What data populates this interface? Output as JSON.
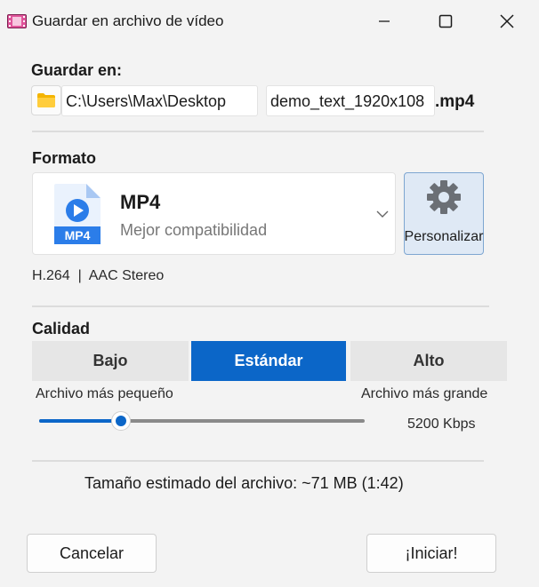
{
  "window": {
    "title": "Guardar en archivo de vídeo"
  },
  "save": {
    "label": "Guardar en:",
    "path": "C:\\Users\\Max\\Desktop",
    "filename": "demo_text_1920x108",
    "extension": ".mp4"
  },
  "format": {
    "label": "Formato",
    "name": "MP4",
    "description": "Mejor compatibilidad",
    "icon_text": "MP4",
    "customize_label": "Personalizar",
    "codec_info": "H.264  |  AAC Stereo"
  },
  "quality": {
    "label": "Calidad",
    "options": [
      "Bajo",
      "Estándar",
      "Alto"
    ],
    "selected": "Estándar",
    "min_label": "Archivo más pequeño",
    "max_label": "Archivo más grande",
    "bitrate": "5200 Kbps",
    "slider_fraction": 0.25
  },
  "estimate": {
    "text": "Tamaño estimado del archivo: ~71 MB (1:42)"
  },
  "actions": {
    "cancel": "Cancelar",
    "start": "¡Iniciar!"
  },
  "colors": {
    "accent": "#0b66c8",
    "folder": "#f4b400",
    "mp4_icon": "#2b7de9"
  }
}
